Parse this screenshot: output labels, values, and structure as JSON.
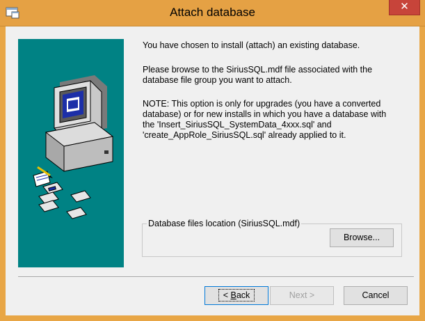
{
  "window": {
    "title": "Attach database",
    "close_label": "✕",
    "accent": "#e5a144"
  },
  "content": {
    "para1": "You have chosen to install (attach) an existing database.",
    "para2_line1": "Please browse to the SiriusSQL.mdf file associated with the",
    "para2_line2": "database file group you want to attach.",
    "para3_line1": "NOTE: This option is only for upgrades (you have a converted",
    "para3_line2": "database) or for new installs in which you have a database with",
    "para3_line3": "the 'Insert_SiriusSQL_SystemData_4xxx.sql' and",
    "para3_line4": "'create_AppRole_SiriusSQL.sql' already applied to it."
  },
  "location_group": {
    "label": "Database files location (SiriusSQL.mdf)",
    "browse_label": "Browse..."
  },
  "footer": {
    "back_prefix": "< ",
    "back_accel": "B",
    "back_rest": "ack",
    "next_label": "Next >",
    "cancel_label": "Cancel"
  },
  "colors": {
    "art_background": "#008284",
    "dialog_background": "#f0f0f0"
  }
}
